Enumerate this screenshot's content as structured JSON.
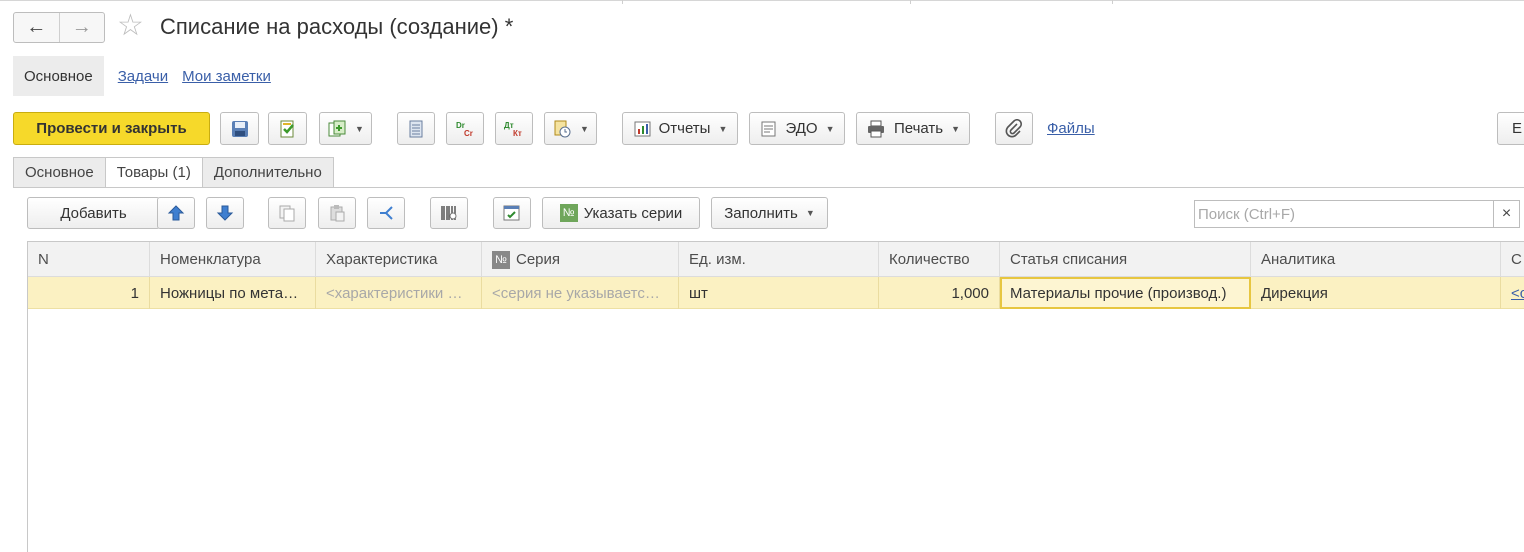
{
  "window": {
    "title": "Списание на расходы (создание) *"
  },
  "section_links": {
    "main": "Основное",
    "tasks": "Задачи",
    "notes": "Мои заметки"
  },
  "toolbar": {
    "post_and_close": "Провести и закрыть",
    "reports": "Отчеты",
    "edo": "ЭДО",
    "print": "Печать",
    "files": "Файлы",
    "more": "Е",
    "dt_kt_1": "Dr Cr",
    "dt_kt_2": "Дт Кт"
  },
  "tabs": [
    {
      "label": "Основное"
    },
    {
      "label": "Товары (1)"
    },
    {
      "label": "Дополнительно"
    }
  ],
  "table_toolbar": {
    "add": "Добавить",
    "set_series": "Указать серии",
    "fill": "Заполнить",
    "search_placeholder": "Поиск (Ctrl+F)",
    "clear": "×"
  },
  "grid": {
    "columns": [
      "N",
      "Номенклатура",
      "Характеристика",
      "Серия",
      "Ед. изм.",
      "Количество",
      "Статья списания",
      "Аналитика",
      "С"
    ],
    "rows": [
      {
        "n": "1",
        "item": "Ножницы по мета…",
        "characteristic": "<характеристики …",
        "series": "<серия не указываетс…",
        "unit": "шт",
        "qty": "1,000",
        "expense_item": "Материалы прочие (производ.)",
        "analytics": "Дирекция",
        "extra": "<с"
      }
    ]
  },
  "colors": {
    "primary_button": "#f6d92a",
    "link": "#3a5fa8",
    "row_highlight": "#fbf1c2",
    "selected_cell_border": "#e7c640"
  }
}
